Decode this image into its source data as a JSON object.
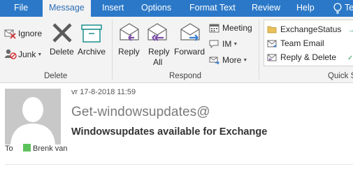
{
  "tabs": [
    {
      "label": "File"
    },
    {
      "label": "Message"
    },
    {
      "label": "Insert"
    },
    {
      "label": "Options"
    },
    {
      "label": "Format Text"
    },
    {
      "label": "Review"
    },
    {
      "label": "Help"
    },
    {
      "label": "Te"
    }
  ],
  "active_tab": "Message",
  "ribbon": {
    "delete_group": {
      "label": "Delete",
      "ignore": "Ignore",
      "junk": "Junk",
      "delete": "Delete",
      "archive": "Archive"
    },
    "respond_group": {
      "label": "Respond",
      "reply": "Reply",
      "reply_all_line1": "Reply",
      "reply_all_line2": "All",
      "forward": "Forward",
      "meeting": "Meeting",
      "im": "IM",
      "more": "More"
    },
    "quick_steps_group": {
      "label": "Quick S",
      "items": [
        "ExchangeStatus",
        "Team Email",
        "Reply & Delete"
      ]
    }
  },
  "message": {
    "date": "vr 17-8-2018 11:59",
    "from": "Get-windowsupdates@",
    "subject": "Windowsupdates available for Exchange",
    "to_label": "To",
    "to_name": "Brenk van"
  },
  "colors": {
    "tab_bar": "#2b78c8",
    "ribbon_bg": "#f3f3f3",
    "presence": "#5cc25b",
    "reply_arrow": "#7b4fa8",
    "forward_arrow": "#3a7fd0"
  }
}
